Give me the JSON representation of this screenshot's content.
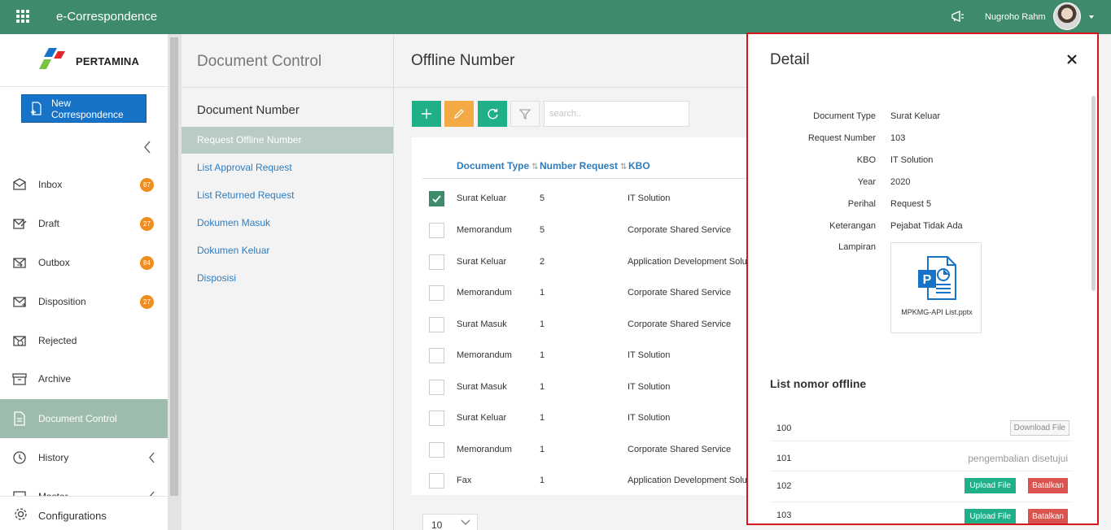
{
  "topbar": {
    "app_title": "e-Correspondence",
    "user_name": "Nugroho Rahm"
  },
  "brand": {
    "logo_text": "PERTAMINA",
    "colors": {
      "primary": "#3e8b6b",
      "accent_blue": "#1673c7",
      "badge": "#ef8d1e"
    }
  },
  "sidebar": {
    "new_button": "New Correspondence",
    "items": [
      {
        "label": "Inbox",
        "icon": "inbox-icon",
        "badge": "87"
      },
      {
        "label": "Draft",
        "icon": "draft-icon",
        "badge": "27"
      },
      {
        "label": "Outbox",
        "icon": "outbox-icon",
        "badge": "84"
      },
      {
        "label": "Disposition",
        "icon": "disposition-icon",
        "badge": "27"
      },
      {
        "label": "Rejected",
        "icon": "rejected-icon"
      },
      {
        "label": "Archive",
        "icon": "archive-icon"
      },
      {
        "label": "Document Control",
        "icon": "document-control-icon",
        "active": true
      },
      {
        "label": "History",
        "icon": "history-icon"
      },
      {
        "label": "Master",
        "icon": "master-icon"
      }
    ],
    "configurations": "Configurations"
  },
  "midcol": {
    "title": "Document Control",
    "section": "Document Number",
    "links": [
      "Request Offline Number",
      "List Approval Request",
      "List Returned Request",
      "Dokumen Masuk",
      "Dokumen Keluar",
      "Disposisi"
    ]
  },
  "main": {
    "title": "Offline Number",
    "search_placeholder": "search..",
    "columns": [
      "Document Type",
      "Number Request",
      "KBO"
    ],
    "rows": [
      {
        "type": "Surat Keluar",
        "num": "5",
        "kbo": "IT Solution",
        "checked": true
      },
      {
        "type": "Memorandum",
        "num": "5",
        "kbo": "Corporate Shared Service"
      },
      {
        "type": "Surat Keluar",
        "num": "2",
        "kbo": "Application Development Solution"
      },
      {
        "type": "Memorandum",
        "num": "1",
        "kbo": "Corporate Shared Service"
      },
      {
        "type": "Surat Masuk",
        "num": "1",
        "kbo": "Corporate Shared Service"
      },
      {
        "type": "Memorandum",
        "num": "1",
        "kbo": "IT Solution"
      },
      {
        "type": "Surat Masuk",
        "num": "1",
        "kbo": "IT Solution"
      },
      {
        "type": "Surat Keluar",
        "num": "1",
        "kbo": "IT Solution"
      },
      {
        "type": "Memorandum",
        "num": "1",
        "kbo": "Corporate Shared Service"
      },
      {
        "type": "Fax",
        "num": "1",
        "kbo": "Application Development Solution"
      }
    ],
    "page_size": "10"
  },
  "detail": {
    "title": "Detail",
    "fields": [
      {
        "label": "Document Type",
        "value": "Surat Keluar"
      },
      {
        "label": "Request Number",
        "value": "103"
      },
      {
        "label": "KBO",
        "value": "IT Solution"
      },
      {
        "label": "Year",
        "value": "2020"
      },
      {
        "label": "Perihal",
        "value": "Request 5"
      },
      {
        "label": "Keterangan",
        "value": "Pejabat Tidak Ada"
      },
      {
        "label": "Lampiran",
        "value": ""
      }
    ],
    "attachment": "MPKMG-API List.pptx",
    "list_title": "List nomor offline",
    "list": [
      {
        "num": "100",
        "action": "Download File"
      },
      {
        "num": "101",
        "status": "pengembalian disetujui"
      },
      {
        "num": "102",
        "upload": "Upload File",
        "cancel": "Batalkan"
      },
      {
        "num": "103",
        "upload": "Upload File",
        "cancel": "Batalkan"
      }
    ]
  }
}
